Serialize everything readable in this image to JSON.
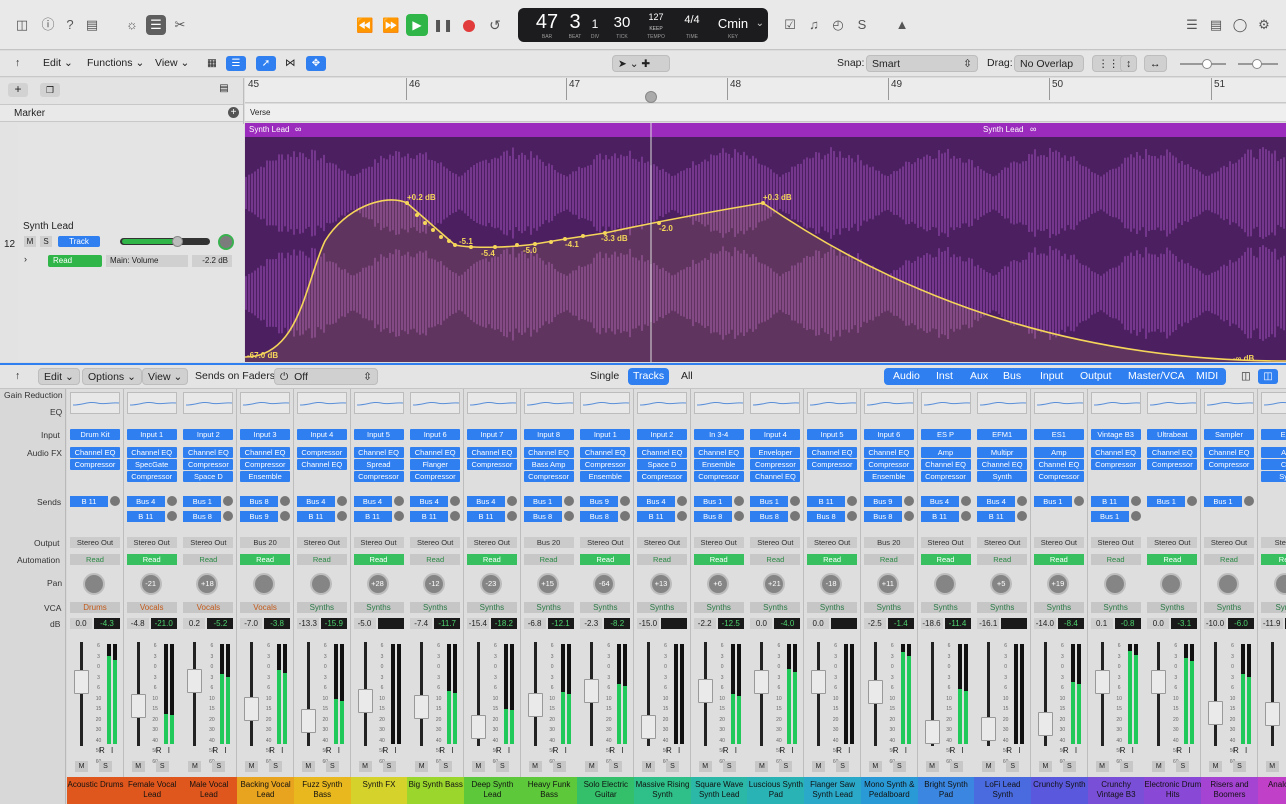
{
  "lcd": {
    "bar": "47",
    "beat": "3",
    "div": "1",
    "tick": "30",
    "tempo": "127",
    "tempo_mode": "KEEP",
    "sig": "4/4",
    "key": "Cmin",
    "lbl_bar": "BAR",
    "lbl_beat": "BEAT",
    "lbl_div": "DIV",
    "lbl_tick": "TICK",
    "lbl_tempo": "TEMPO",
    "lbl_time": "TIME",
    "lbl_key": "KEY"
  },
  "tracks_toolbar": {
    "edit": "Edit",
    "functions": "Functions",
    "view": "View",
    "snap_label": "Snap:",
    "snap": "Smart",
    "drag_label": "Drag:",
    "drag": "No Overlap"
  },
  "ruler": [
    "45",
    "46",
    "47",
    "48",
    "49",
    "50",
    "51"
  ],
  "marker_label": "Marker",
  "marker_name": "Verse",
  "track": {
    "number": "12",
    "name": "Synth Lead",
    "mute": "M",
    "solo": "S",
    "mode": "Track",
    "automation": "Read",
    "param": "Main: Volume",
    "value": "-2.2 dB"
  },
  "region": {
    "name": "Synth Lead",
    "loop_icon": "∞",
    "name2": "Synth Lead"
  },
  "automation_labels": [
    "+0.2 dB",
    "-5.1",
    "-5.4",
    "-5.0",
    "-4.1",
    "-3.3 dB",
    "-2.0",
    "+0.3 dB",
    "-67.0 dB",
    "-∞ dB"
  ],
  "mixer_toolbar": {
    "edit": "Edit",
    "options": "Options",
    "view": "View",
    "sends_label": "Sends on Faders:",
    "sends": "Off",
    "single": "Single",
    "tracks": "Tracks",
    "all": "All",
    "filters": [
      "Audio",
      "Inst",
      "Aux",
      "Bus",
      "Input",
      "Output",
      "Master/VCA",
      "MIDI"
    ]
  },
  "row_labels": [
    "Gain Reduction",
    "EQ",
    "Input",
    "Audio FX",
    "Sends",
    "Output",
    "Automation",
    "Pan",
    "VCA",
    "dB"
  ],
  "fader_scale": [
    "6",
    "3",
    "0",
    "3",
    "6",
    "10",
    "15",
    "20",
    "30",
    "40",
    "50",
    "60"
  ],
  "channels": [
    {
      "input": "Drum Kit",
      "fx": [
        "Channel EQ",
        "Compressor"
      ],
      "sends": [
        "B 11"
      ],
      "output": "Stereo Out",
      "auto": "Read",
      "pan": "",
      "vca": "Drums",
      "db": [
        "0.0",
        "-4.3"
      ],
      "name": "Acoustic Drums",
      "color": "#e0571d",
      "level": 0.72,
      "meter": 0.88
    },
    {
      "input": "Input 1",
      "fx": [
        "Channel EQ",
        "SpecGate",
        "Compressor"
      ],
      "sends": [
        "Bus 4",
        "B 11"
      ],
      "output": "Stereo Out",
      "auto": "Read",
      "pan": "-21",
      "vca": "Vocals",
      "db": [
        "-4.8",
        "-21.0"
      ],
      "name": "Female Vocal Lead",
      "color": "#e0571d",
      "level": 0.48,
      "meter": 0.3
    },
    {
      "input": "Input 2",
      "fx": [
        "Channel EQ",
        "Compressor",
        "Space D"
      ],
      "sends": [
        "Bus 1",
        "Bus 8"
      ],
      "output": "Stereo Out",
      "auto": "Read",
      "pan": "+18",
      "vca": "Vocals",
      "db": [
        "0.2",
        "-5.2"
      ],
      "name": "Male Vocal Lead",
      "color": "#e0571d",
      "level": 0.73,
      "meter": 0.7
    },
    {
      "input": "Input 3",
      "fx": [
        "Channel EQ",
        "Compressor",
        "Ensemble"
      ],
      "sends": [
        "Bus 8",
        "Bus 9"
      ],
      "output": "Bus 20",
      "auto": "Read",
      "pan": "",
      "vca": "Vocals",
      "db": [
        "-7.0",
        "-3.8"
      ],
      "name": "Backing Vocal Lead",
      "color": "#e8a41e",
      "level": 0.45,
      "meter": 0.74
    },
    {
      "input": "Input 4",
      "fx": [
        "Compressor",
        "Channel EQ"
      ],
      "sends": [
        "Bus 4",
        "B 11"
      ],
      "output": "Stereo Out",
      "auto": "Read",
      "pan": "",
      "vca": "Synths",
      "db": [
        "-13.3",
        "-15.9"
      ],
      "name": "Fuzz Synth Bass",
      "color": "#e8b81e",
      "level": 0.33,
      "meter": 0.45
    },
    {
      "input": "Input 5",
      "fx": [
        "Channel EQ",
        "Spread",
        "Compressor"
      ],
      "sends": [
        "Bus 4",
        "B 11"
      ],
      "output": "Stereo Out",
      "auto": "Read",
      "pan": "+28",
      "vca": "Synths",
      "db": [
        "-5.0",
        ""
      ],
      "name": "Synth FX",
      "color": "#d6d22c",
      "level": 0.53,
      "meter": 0.0
    },
    {
      "input": "Input 6",
      "fx": [
        "Channel EQ",
        "Flanger",
        "Compressor"
      ],
      "sends": [
        "Bus 4",
        "B 11"
      ],
      "output": "Stereo Out",
      "auto": "Read",
      "pan": "-12",
      "vca": "Synths",
      "db": [
        "-7.4",
        "-11.7"
      ],
      "name": "Big Synth Bass",
      "color": "#9bd62c",
      "level": 0.47,
      "meter": 0.53
    },
    {
      "input": "Input 7",
      "fx": [
        "Channel EQ",
        "Compressor"
      ],
      "sends": [
        "Bus 4",
        "B 11"
      ],
      "output": "Stereo Out",
      "auto": "Read",
      "pan": "-23",
      "vca": "Synths",
      "db": [
        "-15.4",
        "-18.2"
      ],
      "name": "Deep Synth Lead",
      "color": "#5dc93a",
      "level": 0.27,
      "meter": 0.35
    },
    {
      "input": "Input 8",
      "fx": [
        "Channel EQ",
        "Bass Amp",
        "Compressor"
      ],
      "sends": [
        "Bus 1",
        "Bus 8"
      ],
      "output": "Bus 20",
      "auto": "Read",
      "pan": "+15",
      "vca": "Synths",
      "db": [
        "-6.8",
        "-12.1"
      ],
      "name": "Heavy Funk Bass",
      "color": "#5dc93a",
      "level": 0.49,
      "meter": 0.52
    },
    {
      "input": "Input 1",
      "fx": [
        "Channel EQ",
        "Compressor",
        "Ensemble"
      ],
      "sends": [
        "Bus 9",
        "Bus 8"
      ],
      "output": "Stereo Out",
      "auto": "Read",
      "pan": "-64",
      "vca": "Synths",
      "db": [
        "-2.3",
        "-8.2"
      ],
      "name": "Solo Electric Guitar",
      "color": "#34c06a",
      "level": 0.63,
      "meter": 0.6
    },
    {
      "input": "Input 2",
      "fx": [
        "Channel EQ",
        "Space D",
        "Compressor"
      ],
      "sends": [
        "Bus 4",
        "B 11"
      ],
      "output": "Stereo Out",
      "auto": "Read",
      "pan": "+13",
      "vca": "Synths",
      "db": [
        "-15.0",
        ""
      ],
      "name": "Massive Rising Synth",
      "color": "#2fc089",
      "level": 0.27,
      "meter": 0.0
    },
    {
      "input": "In 3-4",
      "fx": [
        "Channel EQ",
        "Ensemble",
        "Compressor"
      ],
      "sends": [
        "Bus 1",
        "Bus 8"
      ],
      "output": "Stereo Out",
      "auto": "Read",
      "pan": "+6",
      "vca": "Synths",
      "db": [
        "-2.2",
        "-12.5"
      ],
      "name": "Square Wave Synth Lead",
      "color": "#2cb8a6",
      "level": 0.63,
      "meter": 0.5
    },
    {
      "input": "Input 4",
      "fx": [
        "Enveloper",
        "Compressor",
        "Channel EQ"
      ],
      "sends": [
        "Bus 1",
        "Bus 8"
      ],
      "output": "Stereo Out",
      "auto": "Read",
      "pan": "+21",
      "vca": "Synths",
      "db": [
        "0.0",
        "-4.0"
      ],
      "name": "Luscious Synth Pad",
      "color": "#2ab3b5",
      "level": 0.72,
      "meter": 0.75
    },
    {
      "input": "Input 5",
      "fx": [
        "Channel EQ",
        "Compressor"
      ],
      "sends": [
        "B 11",
        "Bus 8"
      ],
      "output": "Stereo Out",
      "auto": "Read",
      "pan": "-18",
      "vca": "Synths",
      "db": [
        "0.0",
        ""
      ],
      "name": "Flanger Saw Synth Lead",
      "color": "#2aa9c9",
      "level": 0.72,
      "meter": 0.0
    },
    {
      "input": "Input 6",
      "fx": [
        "Channel EQ",
        "Compressor",
        "Ensemble"
      ],
      "sends": [
        "Bus 9",
        "Bus 8"
      ],
      "output": "Bus 20",
      "auto": "Read",
      "pan": "+11",
      "vca": "Synths",
      "db": [
        "-2.5",
        "-1.4"
      ],
      "name": "Mono Synth & Pedalboard",
      "color": "#2a9ad6",
      "level": 0.62,
      "meter": 0.92
    },
    {
      "input": "ES P",
      "fx": [
        "Amp",
        "Channel EQ",
        "Compressor"
      ],
      "sends": [
        "Bus 4",
        "B 11"
      ],
      "output": "Stereo Out",
      "auto": "Read",
      "pan": "",
      "vca": "Synths",
      "db": [
        "-18.6",
        "-11.4"
      ],
      "name": "Bright Synth Pad",
      "color": "#3a86e0",
      "level": 0.22,
      "meter": 0.55
    },
    {
      "input": "EFM1",
      "fx": [
        "Multipr",
        "Channel EQ",
        "Synth"
      ],
      "sends": [
        "Bus 4",
        "B 11"
      ],
      "output": "Stereo Out",
      "auto": "Read",
      "pan": "+5",
      "vca": "Synths",
      "db": [
        "-16.1",
        ""
      ],
      "name": "LoFi Lead Synth",
      "color": "#4a6be0",
      "level": 0.25,
      "meter": 0.0
    },
    {
      "input": "ES1",
      "fx": [
        "Amp",
        "Channel EQ",
        "Compressor"
      ],
      "sends": [
        "Bus 1"
      ],
      "output": "Stereo Out",
      "auto": "Read",
      "pan": "+19",
      "vca": "Synths",
      "db": [
        "-14.0",
        "-8.4"
      ],
      "name": "Crunchy Synth",
      "color": "#5a58dc",
      "level": 0.3,
      "meter": 0.62
    },
    {
      "input": "Vintage B3",
      "fx": [
        "Channel EQ",
        "Compressor"
      ],
      "sends": [
        "B 11",
        "Bus 1"
      ],
      "output": "Stereo Out",
      "auto": "Read",
      "pan": "",
      "vca": "Synths",
      "db": [
        "0.1",
        "-0.8"
      ],
      "name": "Crunchy Vintage B3",
      "color": "#7a4fd8",
      "level": 0.72,
      "meter": 0.93
    },
    {
      "input": "Ultrabeat",
      "fx": [
        "Channel EQ",
        "Compressor"
      ],
      "sends": [
        "Bus 1"
      ],
      "output": "Stereo Out",
      "auto": "Read",
      "pan": "",
      "vca": "Synths",
      "db": [
        "0.0",
        "-3.1"
      ],
      "name": "Electronic Drum Hits",
      "color": "#8a48d6",
      "level": 0.72,
      "meter": 0.86
    },
    {
      "input": "Sampler",
      "fx": [
        "Channel EQ",
        "Compressor"
      ],
      "sends": [
        "Bus 1"
      ],
      "output": "Stereo Out",
      "auto": "Read",
      "pan": "",
      "vca": "Synths",
      "db": [
        "-10.0",
        "-6.0"
      ],
      "name": "Risers and Boomers",
      "color": "#a544d2",
      "level": 0.41,
      "meter": 0.7
    },
    {
      "input": "ES",
      "fx": [
        "An",
        "Ch",
        "Syn"
      ],
      "sends": [],
      "output": "Stereo",
      "auto": "Rea",
      "pan": "",
      "vca": "Synth",
      "db": [
        "-11.9",
        ""
      ],
      "name": "Analog Sy",
      "color": "#c040c8",
      "level": 0.4,
      "meter": 0.0
    }
  ],
  "colors": {
    "accent": "#2f7ff1",
    "region": "#4b1f60",
    "region_header": "#9b2bbd",
    "automation": "#f5d55a"
  }
}
